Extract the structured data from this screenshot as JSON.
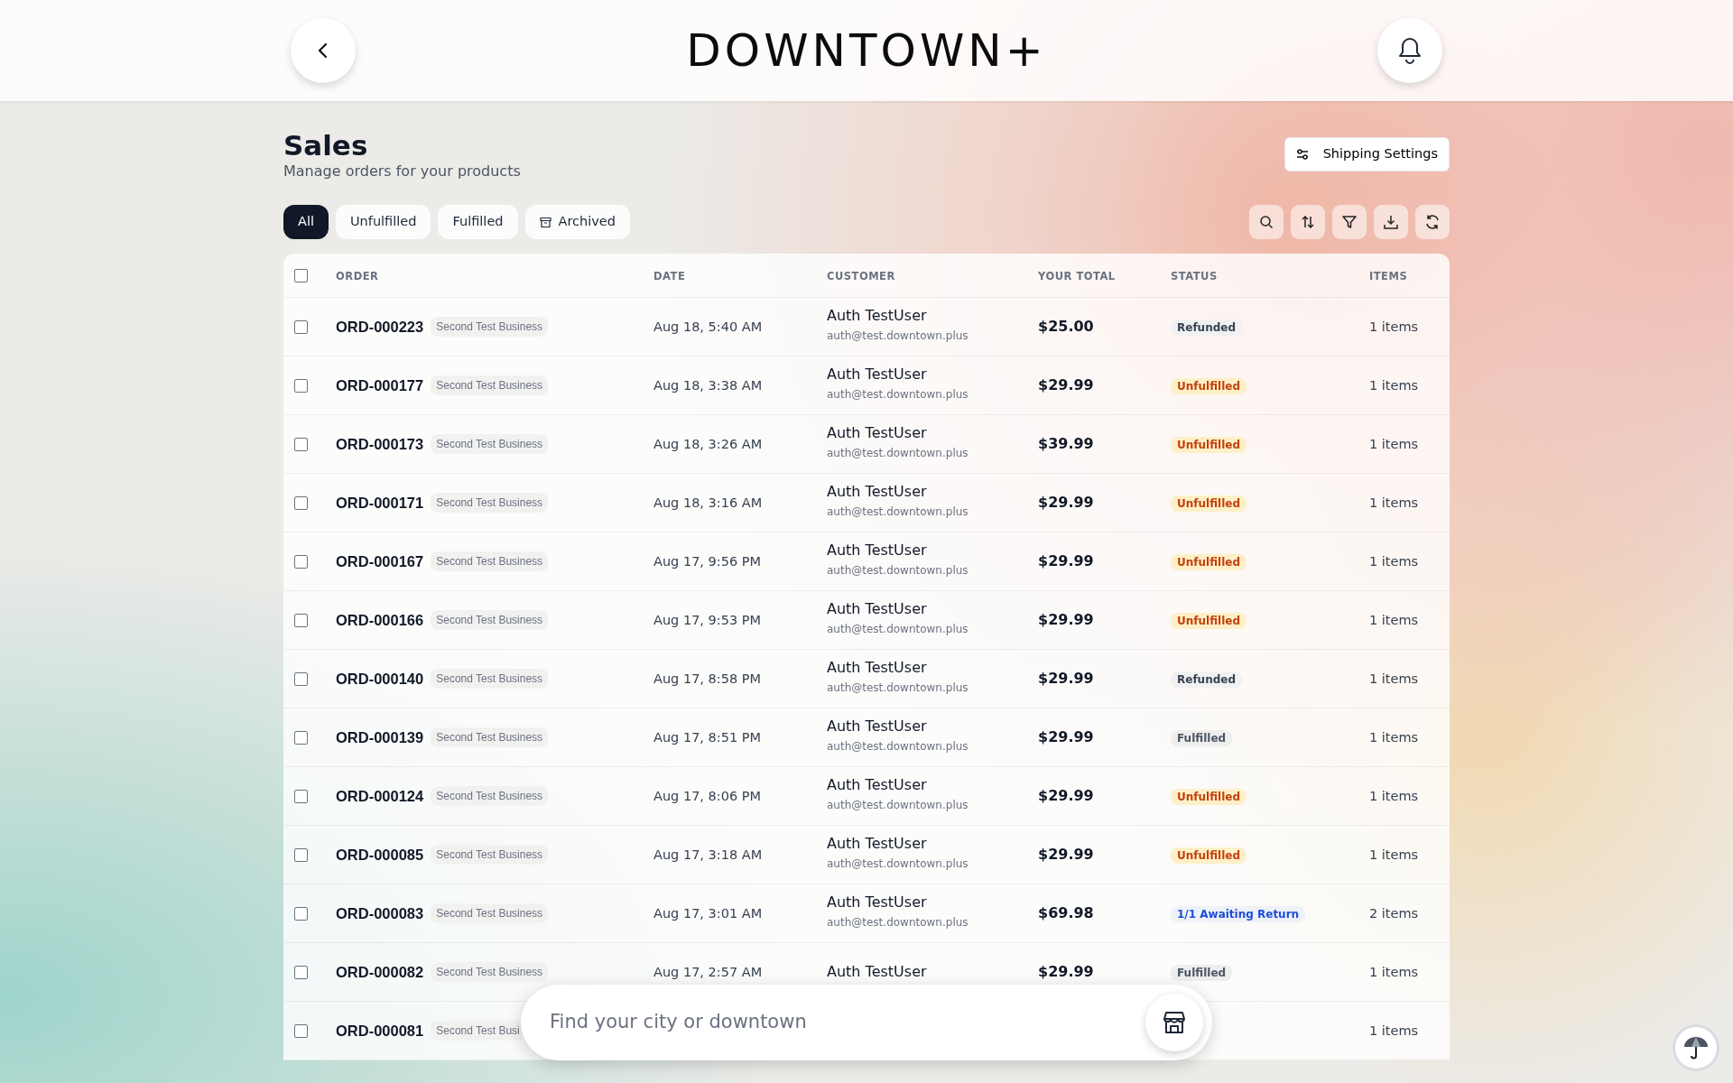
{
  "header": {
    "logo": "DOWNTOWN+"
  },
  "page": {
    "title": "Sales",
    "subtitle": "Manage orders for your products",
    "settings_button": "Shipping Settings"
  },
  "filters": [
    {
      "label": "All",
      "selected": true,
      "icon": false
    },
    {
      "label": "Unfulfilled",
      "selected": false,
      "icon": false
    },
    {
      "label": "Fulfilled",
      "selected": false,
      "icon": false
    },
    {
      "label": "Archived",
      "selected": false,
      "icon": true
    }
  ],
  "table": {
    "select_all": {
      "checked": false
    },
    "columns": [
      "ORDER",
      "DATE",
      "CUSTOMER",
      "YOUR TOTAL",
      "STATUS",
      "ITEMS"
    ],
    "rows": [
      {
        "checked": false,
        "order": "ORD-000223",
        "business": "Second Test Business",
        "date": "Aug 18, 5:40 AM",
        "customer": "Auth TestUser",
        "email": "auth@test.downtown.plus",
        "total": "$25.00",
        "status": {
          "label": "Refunded",
          "kind": "refunded"
        },
        "items": "1 items"
      },
      {
        "checked": false,
        "order": "ORD-000177",
        "business": "Second Test Business",
        "date": "Aug 18, 3:38 AM",
        "customer": "Auth TestUser",
        "email": "auth@test.downtown.plus",
        "total": "$29.99",
        "status": {
          "label": "Unfulfilled",
          "kind": "unfulfilled"
        },
        "items": "1 items"
      },
      {
        "checked": false,
        "order": "ORD-000173",
        "business": "Second Test Business",
        "date": "Aug 18, 3:26 AM",
        "customer": "Auth TestUser",
        "email": "auth@test.downtown.plus",
        "total": "$39.99",
        "status": {
          "label": "Unfulfilled",
          "kind": "unfulfilled"
        },
        "items": "1 items"
      },
      {
        "checked": false,
        "order": "ORD-000171",
        "business": "Second Test Business",
        "date": "Aug 18, 3:16 AM",
        "customer": "Auth TestUser",
        "email": "auth@test.downtown.plus",
        "total": "$29.99",
        "status": {
          "label": "Unfulfilled",
          "kind": "unfulfilled"
        },
        "items": "1 items"
      },
      {
        "checked": false,
        "order": "ORD-000167",
        "business": "Second Test Business",
        "date": "Aug 17, 9:56 PM",
        "customer": "Auth TestUser",
        "email": "auth@test.downtown.plus",
        "total": "$29.99",
        "status": {
          "label": "Unfulfilled",
          "kind": "unfulfilled"
        },
        "items": "1 items"
      },
      {
        "checked": false,
        "order": "ORD-000166",
        "business": "Second Test Business",
        "date": "Aug 17, 9:53 PM",
        "customer": "Auth TestUser",
        "email": "auth@test.downtown.plus",
        "total": "$29.99",
        "status": {
          "label": "Unfulfilled",
          "kind": "unfulfilled"
        },
        "items": "1 items"
      },
      {
        "checked": false,
        "order": "ORD-000140",
        "business": "Second Test Business",
        "date": "Aug 17, 8:58 PM",
        "customer": "Auth TestUser",
        "email": "auth@test.downtown.plus",
        "total": "$29.99",
        "status": {
          "label": "Refunded",
          "kind": "refunded"
        },
        "items": "1 items"
      },
      {
        "checked": false,
        "order": "ORD-000139",
        "business": "Second Test Business",
        "date": "Aug 17, 8:51 PM",
        "customer": "Auth TestUser",
        "email": "auth@test.downtown.plus",
        "total": "$29.99",
        "status": {
          "label": "Fulfilled",
          "kind": "fulfilled"
        },
        "items": "1 items"
      },
      {
        "checked": false,
        "order": "ORD-000124",
        "business": "Second Test Business",
        "date": "Aug 17, 8:06 PM",
        "customer": "Auth TestUser",
        "email": "auth@test.downtown.plus",
        "total": "$29.99",
        "status": {
          "label": "Unfulfilled",
          "kind": "unfulfilled"
        },
        "items": "1 items"
      },
      {
        "checked": false,
        "order": "ORD-000085",
        "business": "Second Test Business",
        "date": "Aug 17, 3:18 AM",
        "customer": "Auth TestUser",
        "email": "auth@test.downtown.plus",
        "total": "$29.99",
        "status": {
          "label": "Unfulfilled",
          "kind": "unfulfilled"
        },
        "items": "1 items"
      },
      {
        "checked": false,
        "order": "ORD-000083",
        "business": "Second Test Business",
        "date": "Aug 17, 3:01 AM",
        "customer": "Auth TestUser",
        "email": "auth@test.downtown.plus",
        "total": "$69.98",
        "status": {
          "label": "1/1 Awaiting Return",
          "kind": "awaiting"
        },
        "items": "2 items"
      },
      {
        "checked": false,
        "order": "ORD-000082",
        "business": "Second Test Business",
        "date": "Aug 17, 2:57 AM",
        "customer": "Auth TestUser",
        "total": "$29.99",
        "status": {
          "label": "Fulfilled",
          "kind": "fulfilled"
        },
        "items": "1 items"
      },
      {
        "checked": false,
        "order": "ORD-000081",
        "business": "Second Test Busi",
        "items": "1 items"
      }
    ]
  },
  "search": {
    "placeholder": "Find your city or downtown"
  }
}
